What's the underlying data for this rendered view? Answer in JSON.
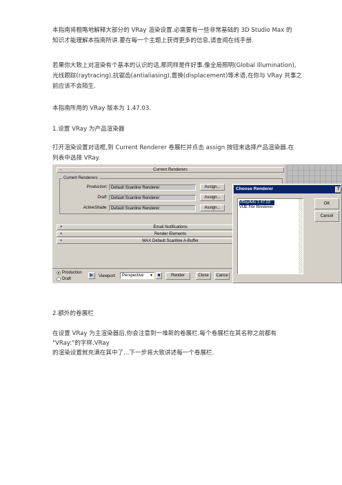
{
  "paragraphs": {
    "p1_l1": "本指南将粗略地解释大部分的 VRay 渲染设置.必需要有一些非常基础的 3D Studio Max 的",
    "p1_l2": "知识才能理解本指南所讲.要在每一个主题上获得更多的信息,请查阅在线手册.",
    "p2_l1": "若果你大致上对渲染有个基本的认识的话,那同样是件好事.像全局照明(Global Illumination),",
    "p2_l2": "光线跟踪(raytracing),抗锯齿(antialiasing),置换(displacement)等术语,在你与 VRay 共事之",
    "p2_l3": "前应该不会陌生.",
    "p3": "本指南所用的 VRay 版本为 1.47.03.",
    "h1": "1.设置 VRay 为产品渲染器",
    "p4_l1": "打开渲染设置对话框,到 Current Renderer 卷展栏并点击 assign 按钮来选择产品渲染器.在",
    "p4_l2": "列表中选择 VRay.",
    "h2": "2.额外的卷展栏",
    "p5_l1": "在设置 VRay 为主渲染器后,你会注意到一堆新的卷展栏.每个卷展栏在其名称之前都有",
    "p5_l2": "\"VRay:\"的字样,VRay",
    "p5_l3": "的渲染设置就充满在其中了...下一步将大致讲述每一个卷展栏."
  },
  "screenshot": {
    "current_renderers_rollout": {
      "sign": "-",
      "title": "Current Renderers",
      "group_label": "Current Renderers",
      "rows": [
        {
          "label": "Production:",
          "value": "Default Scanline Renderer",
          "button": "Assign..."
        },
        {
          "label": "Draft:",
          "value": "Default Scanline Renderer",
          "button": "Assign..."
        },
        {
          "label": "ActiveShade:",
          "value": "Default Scanline Renderer",
          "button": "Assign..."
        }
      ]
    },
    "collapsed_rollouts": [
      {
        "sign": "+",
        "title": "Email Notifications"
      },
      {
        "sign": "+",
        "title": "Render Elements"
      },
      {
        "sign": "+",
        "title": "MAX Default Scanline A-Buffer"
      }
    ],
    "bottom_bar": {
      "radio_production": "Production",
      "radio_draft": "Draft",
      "viewport_label": "Viewport:",
      "viewport_value": "Perspective",
      "render": "Render",
      "close": "Close",
      "cancel": "Cance"
    },
    "dialog": {
      "title": "Choose Renderer",
      "help": "?",
      "items": [
        "VRayAdv 1.47.03",
        "VUE File Renderer"
      ],
      "selected_index": 0,
      "ok": "OK",
      "cancel": "Cancel"
    }
  },
  "colors": {
    "window_face": "#d4d0c8",
    "dialog_title_bar": "#0a246a",
    "selection": "#0a246a",
    "body_text": "#333333"
  }
}
